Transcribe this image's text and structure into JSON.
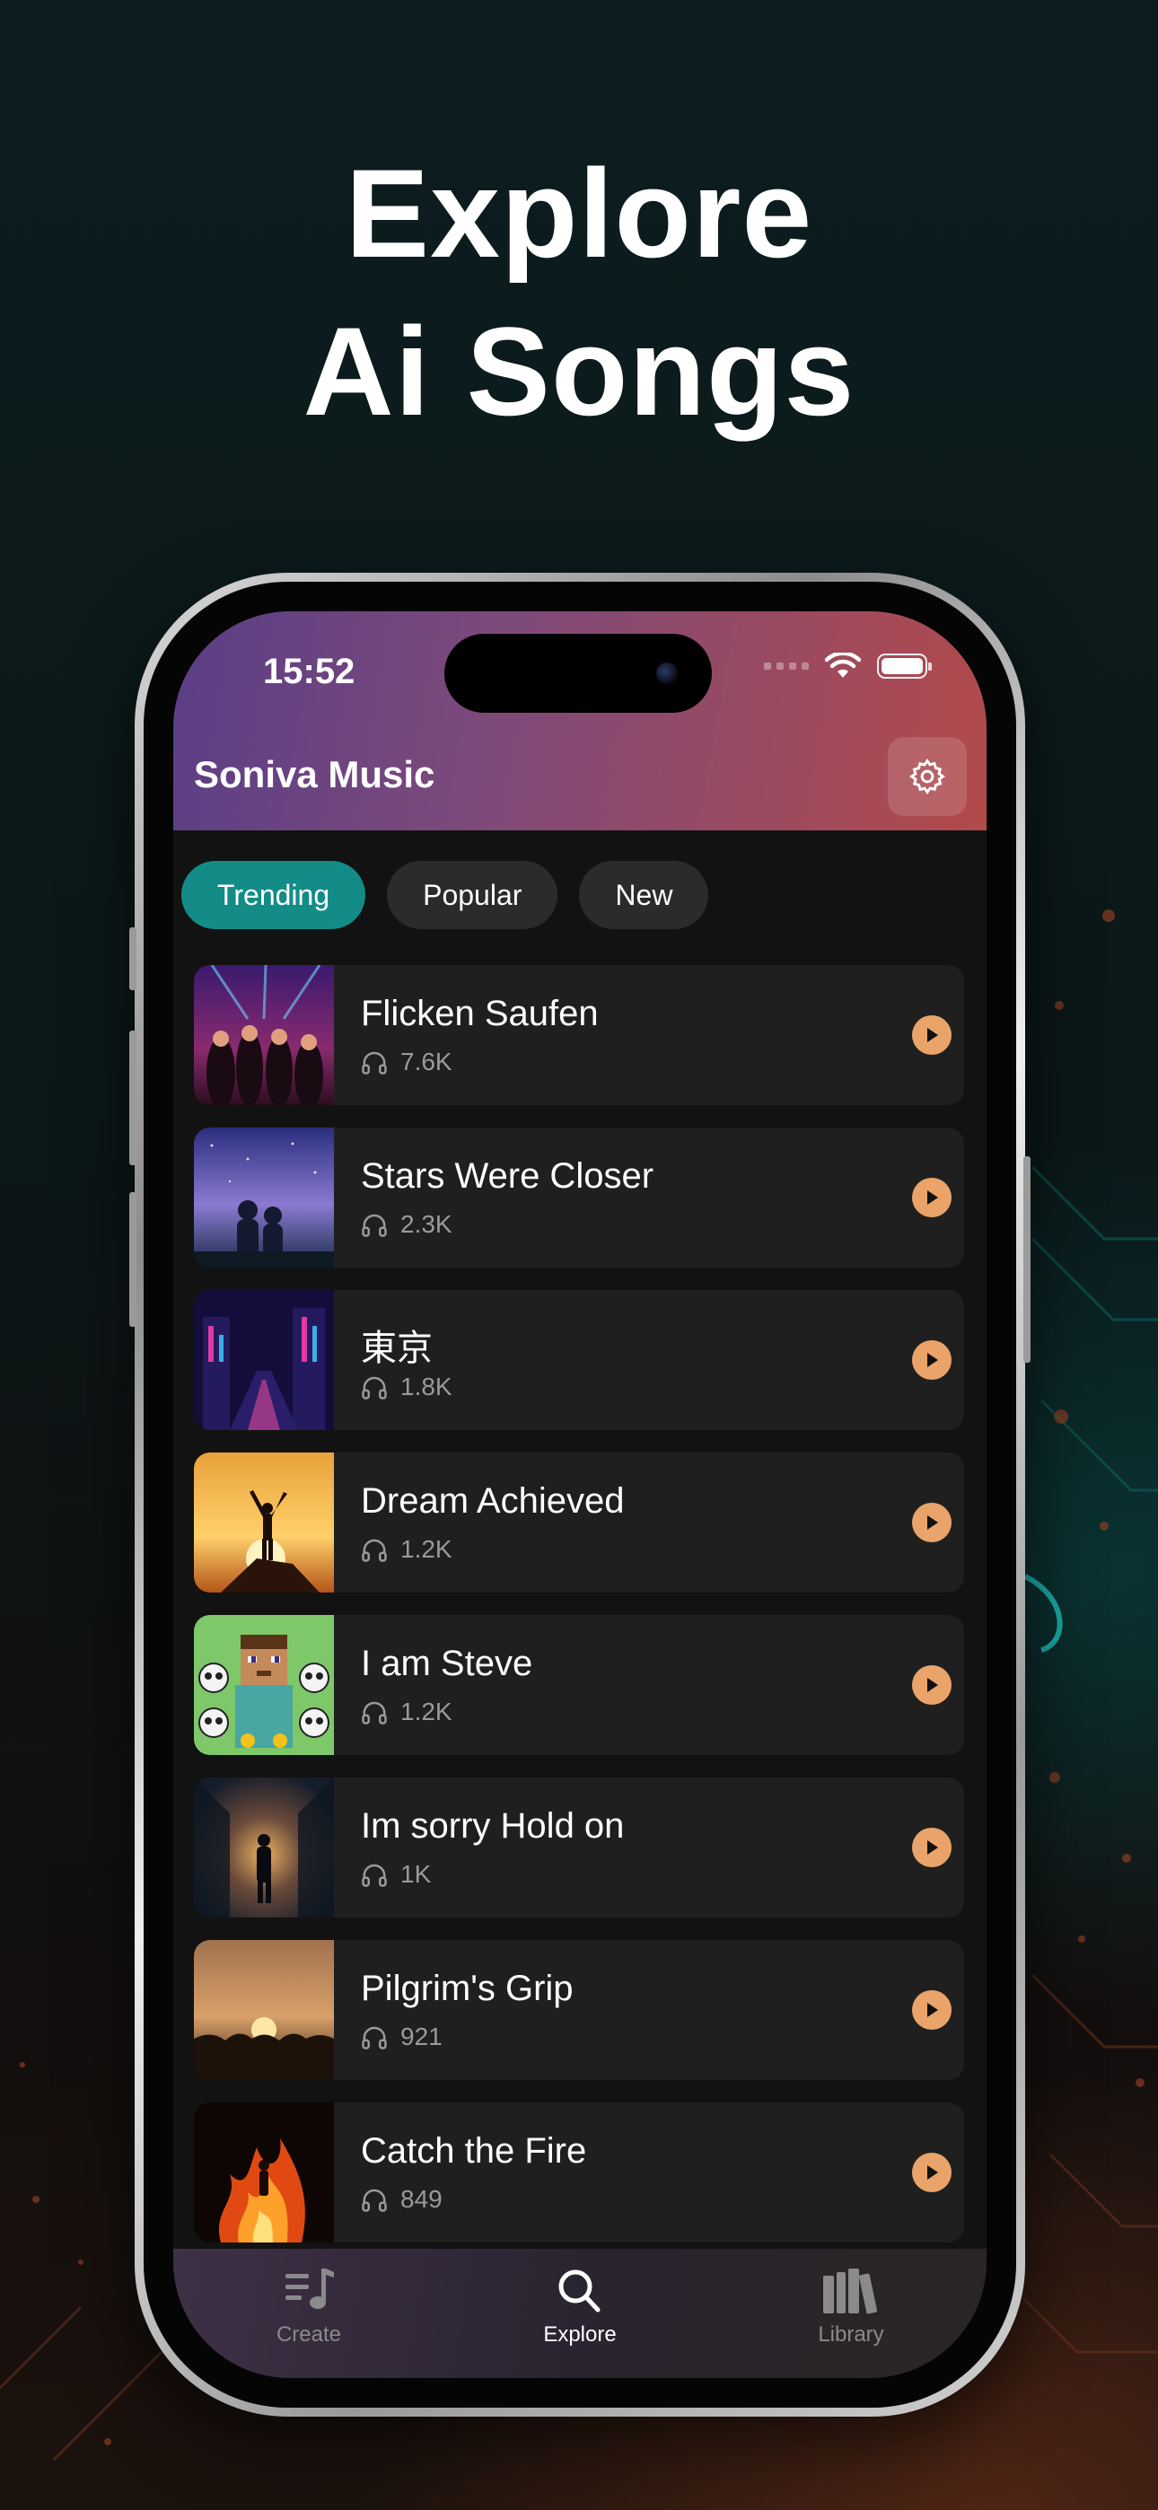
{
  "headline": {
    "line1": "Explore",
    "line2": "Ai Songs"
  },
  "status_bar": {
    "time": "15:52"
  },
  "app": {
    "title": "Soniva Music"
  },
  "filters": [
    {
      "label": "Trending",
      "active": true
    },
    {
      "label": "Popular",
      "active": false
    },
    {
      "label": "New",
      "active": false
    }
  ],
  "songs": [
    {
      "title": "Flicken Saufen",
      "plays": "7.6K"
    },
    {
      "title": "Stars Were Closer",
      "plays": "2.3K"
    },
    {
      "title": "東京",
      "plays": "1.8K"
    },
    {
      "title": "Dream Achieved",
      "plays": "1.2K"
    },
    {
      "title": "I am Steve",
      "plays": "1.2K"
    },
    {
      "title": "Im sorry Hold on",
      "plays": "1K"
    },
    {
      "title": "Pilgrim's Grip",
      "plays": "921"
    },
    {
      "title": "Catch the Fire",
      "plays": "849"
    }
  ],
  "tabbar": [
    {
      "label": "Create",
      "icon": "music-list-icon"
    },
    {
      "label": "Explore",
      "icon": "search-icon",
      "active": true
    },
    {
      "label": "Library",
      "icon": "books-icon"
    }
  ],
  "colors": {
    "accent_tab": "#138c88",
    "play_button": "#eaa469"
  }
}
